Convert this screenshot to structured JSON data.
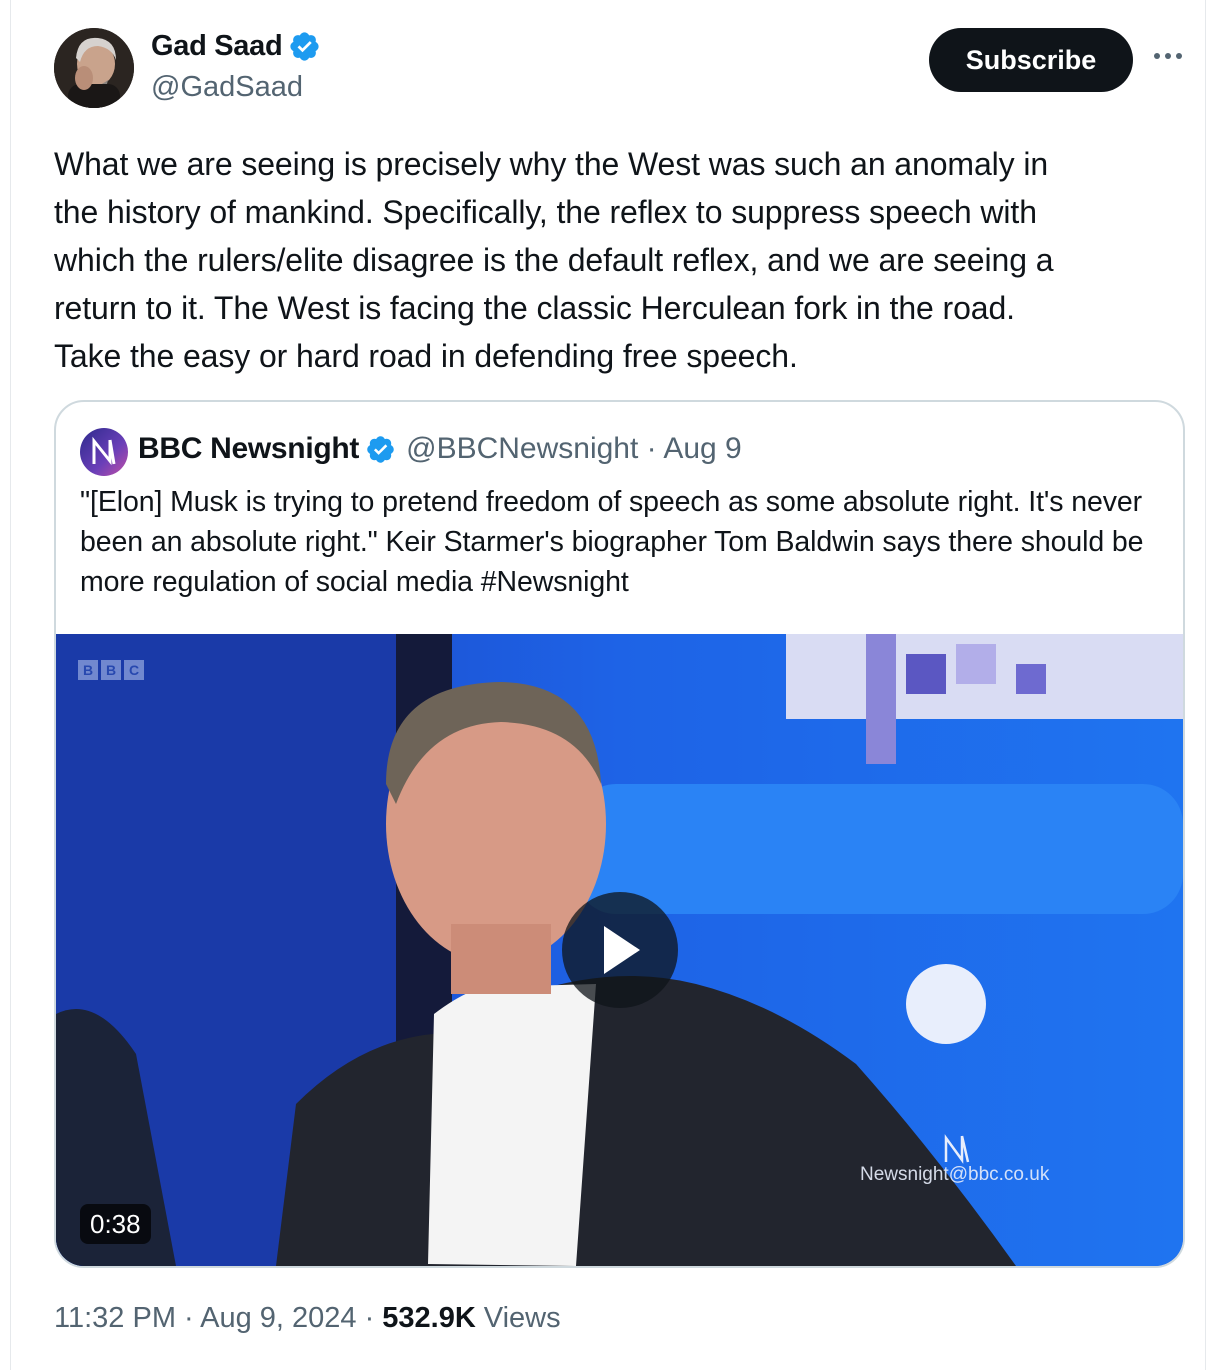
{
  "author": {
    "name": "Gad Saad",
    "handle": "@GadSaad",
    "verified": true,
    "avatar_icon": "profile-photo"
  },
  "actions": {
    "subscribe_label": "Subscribe",
    "more_icon": "more-dots-icon"
  },
  "tweet": {
    "text": "What we are seeing is precisely why the West was such an anomaly in\nthe history of mankind.  Specifically, the reflex to suppress speech with\nwhich the rulers/elite disagree is the default reflex, and we are seeing a\nreturn to it.  The West is facing the classic Herculean fork in the road.\nTake the easy or hard road in defending free speech."
  },
  "quote": {
    "name": "BBC Newsnight",
    "handle": "@BBCNewsnight",
    "separator": "·",
    "date": "Aug 9",
    "meta": "@BBCNewsnight · Aug 9",
    "text": "\"[Elon] Musk is trying to pretend freedom of speech as some absolute right. It's never been an absolute right.\" Keir Starmer's biographer Tom Baldwin says there should be more regulation of social media #Newsnight",
    "video": {
      "duration": "0:38",
      "watermark": "Newsnight@bbc.co.uk",
      "channel_bug": [
        "B",
        "B",
        "C"
      ]
    }
  },
  "footer": {
    "time_date": "11:32 PM · Aug 9, 2024 ·",
    "views_count": "532.9K",
    "views_label": "Views"
  },
  "colors": {
    "text": "#0f1419",
    "secondary": "#536471",
    "verified_blue": "#1d9bf0",
    "border": "#cfd9de",
    "subscribe_bg": "#0f1419"
  }
}
